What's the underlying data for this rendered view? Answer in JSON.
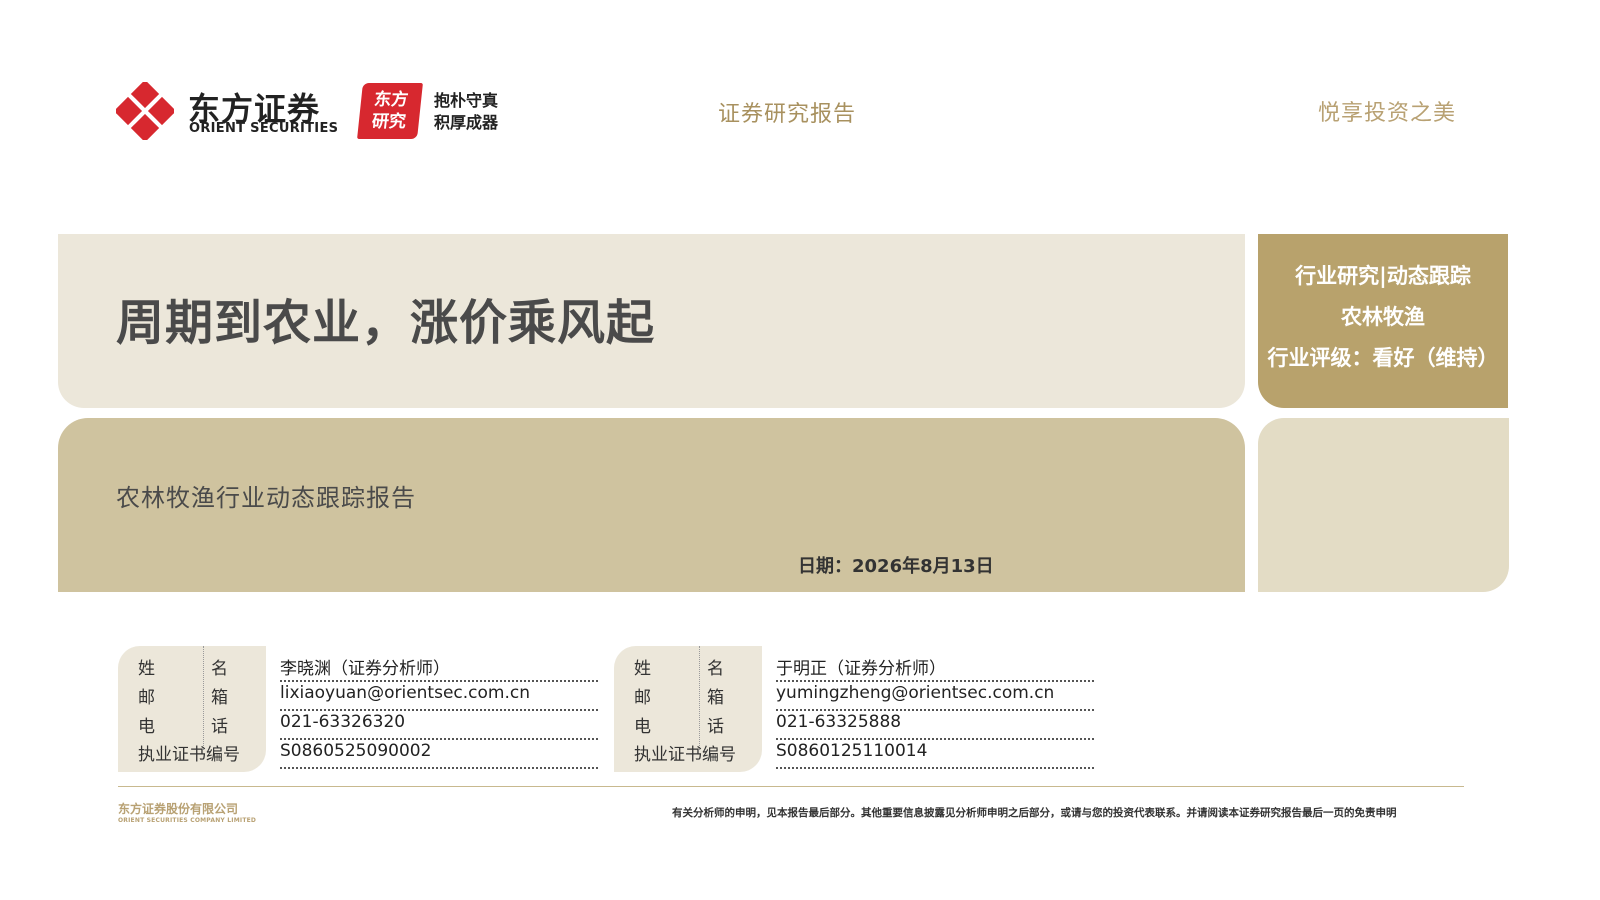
{
  "header": {
    "brand_cn": "东方证券",
    "brand_en": "ORIENT SECURITIES",
    "research_badge_line1": "东方",
    "research_badge_line2": "研究",
    "slogan_line1": "抱朴守真",
    "slogan_line2": "积厚成器",
    "center_text": "证券研究报告",
    "right_text": "悦享投资之美"
  },
  "title": "周期到农业，涨价乘风起",
  "meta": {
    "report_type": "行业研究|动态跟踪",
    "sector": "农林牧渔",
    "rating": "行业评级：看好（维持）"
  },
  "subtitle": "农林牧渔行业动态跟踪报告",
  "date": "日期：2026年8月13日",
  "analyst_labels": {
    "name_a": "姓",
    "name_b": "名",
    "email_a": "邮",
    "email_b": "箱",
    "phone_a": "电",
    "phone_b": "话",
    "license": "执业证书编号"
  },
  "analysts": [
    {
      "name": "李晓渊（证券分析师）",
      "email": "lixiaoyuan@orientsec.com.cn",
      "phone": "021-63326320",
      "license": "S0860525090002"
    },
    {
      "name": "于明正（证券分析师）",
      "email": "yumingzheng@orientsec.com.cn",
      "phone": "021-63325888",
      "license": "S0860125110014"
    }
  ],
  "footer": {
    "company_cn": "东方证券股份有限公司",
    "company_en": "ORIENT SECURITIES COMPANY LIMITED",
    "disclaimer": "有关分析师的申明，见本报告最后部分。其他重要信息披露见分析师申明之后部分，或请与您的投资代表联系。并请阅读本证券研究报告最后一页的免责申明"
  },
  "colors": {
    "brand_red": "#d7282f",
    "gold": "#b8a26c",
    "light_beige": "#ece7da",
    "mid_beige": "#cfc39f",
    "side_beige": "#e3dcc5"
  },
  "icons": {
    "logo": "orient-securities-logo-icon"
  }
}
